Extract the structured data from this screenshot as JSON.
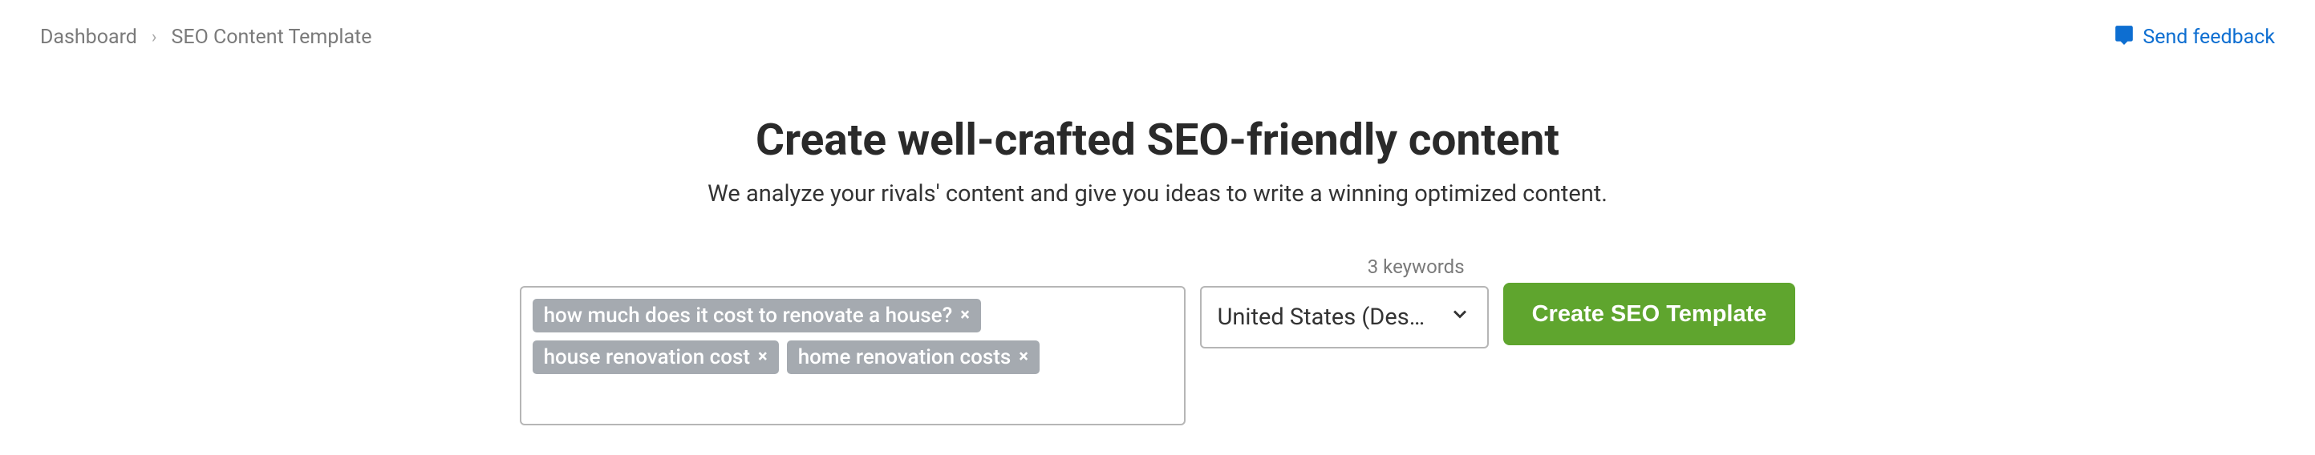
{
  "breadcrumb": {
    "parent": "Dashboard",
    "current": "SEO Content Template"
  },
  "feedback_label": "Send feedback",
  "title": "Create well-crafted SEO-friendly content",
  "subtitle": "We analyze your rivals' content and give you ideas to write a winning optimized content.",
  "keyword_count_label": "3 keywords",
  "keywords": [
    "how much does it cost to renovate a house?",
    "house renovation cost",
    "home renovation costs"
  ],
  "location_selected": "United States (Des…",
  "submit_label": "Create SEO Template"
}
